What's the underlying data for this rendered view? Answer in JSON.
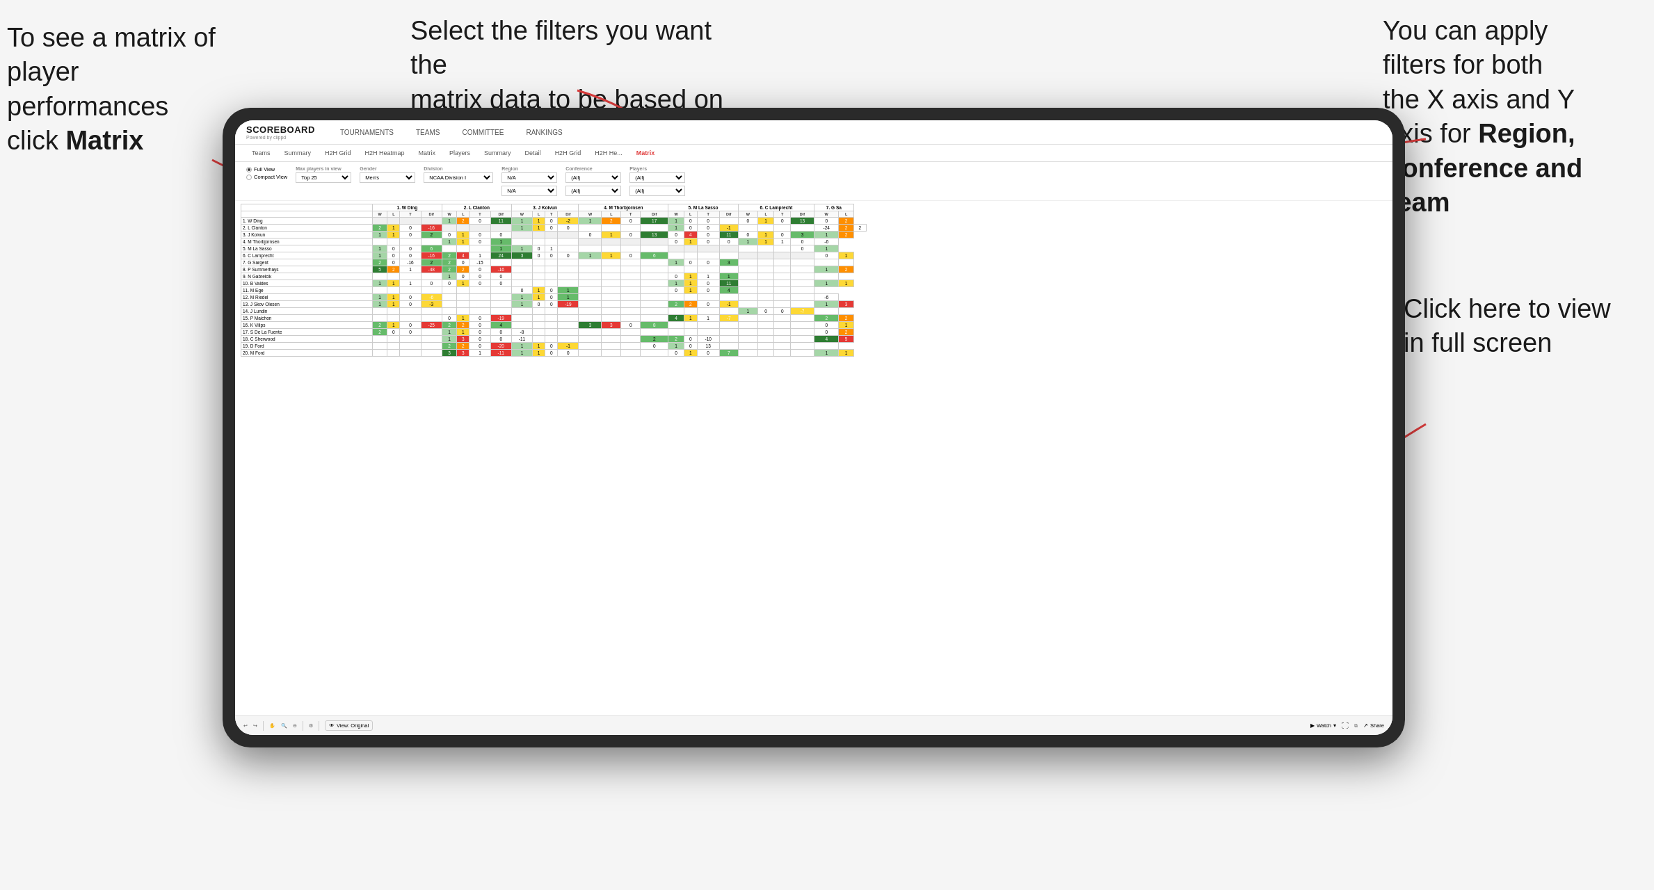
{
  "annotations": {
    "left": {
      "line1": "To see a matrix of",
      "line2": "player performances",
      "line3": "click ",
      "line3bold": "Matrix"
    },
    "center": {
      "line1": "Select the filters you want the",
      "line2": "matrix data to be based on"
    },
    "right": {
      "line1": "You  can apply",
      "line2": "filters for both",
      "line3": "the X axis and Y",
      "line4": "Axis for ",
      "line4bold": "Region,",
      "line5bold": "Conference and",
      "line6bold": "Team"
    },
    "bottomRight": {
      "line1": "Click here to view",
      "line2": "in full screen"
    }
  },
  "nav": {
    "logo": "SCOREBOARD",
    "poweredBy": "Powered by clippd",
    "items": [
      "TOURNAMENTS",
      "TEAMS",
      "COMMITTEE",
      "RANKINGS"
    ]
  },
  "subNav": {
    "items": [
      "Teams",
      "Summary",
      "H2H Grid",
      "H2H Heatmap",
      "Matrix",
      "Players",
      "Summary",
      "Detail",
      "H2H Grid",
      "H2H He...",
      "Matrix"
    ],
    "activeItem": "Matrix"
  },
  "filters": {
    "view": {
      "label": "",
      "options": [
        "Full View",
        "Compact View"
      ],
      "selected": "Full View"
    },
    "maxPlayers": {
      "label": "Max players in view",
      "value": "Top 25"
    },
    "gender": {
      "label": "Gender",
      "value": "Men's"
    },
    "division": {
      "label": "Division",
      "value": "NCAA Division I"
    },
    "region": {
      "label": "Region",
      "values": [
        "N/A",
        "N/A"
      ]
    },
    "conference": {
      "label": "Conference",
      "values": [
        "(All)",
        "(All)"
      ]
    },
    "players": {
      "label": "Players",
      "values": [
        "(All)",
        "(All)"
      ]
    }
  },
  "matrix": {
    "columnHeaders": [
      "1. W Ding",
      "2. L Clanton",
      "3. J Koivun",
      "4. M Thorbjornsen",
      "5. M La Sasso",
      "6. C Lamprecht",
      "7. G Sa"
    ],
    "subHeaders": [
      "W",
      "L",
      "T",
      "Dif"
    ],
    "rows": [
      {
        "name": "1. W Ding",
        "cells": [
          "",
          "",
          "",
          "",
          "1",
          "2",
          "0",
          "11",
          "1",
          "1",
          "0",
          "-2",
          "1",
          "2",
          "0",
          "17",
          "1",
          "0",
          "0",
          "",
          "0",
          "1",
          "0",
          "13",
          "0",
          "2"
        ]
      },
      {
        "name": "2. L Clanton",
        "cells": [
          "2",
          "1",
          "0",
          "-16",
          "",
          "",
          "",
          "",
          "1",
          "1",
          "0",
          "0",
          "",
          "",
          "",
          "",
          "1",
          "0",
          "0",
          "-1",
          "",
          "",
          "",
          "",
          "-24",
          "2",
          "2"
        ]
      },
      {
        "name": "3. J Koivun",
        "cells": [
          "1",
          "1",
          "0",
          "2",
          "0",
          "1",
          "0",
          "0",
          "",
          "",
          "",
          "",
          "0",
          "1",
          "0",
          "13",
          "0",
          "4",
          "0",
          "11",
          "0",
          "1",
          "0",
          "3",
          "1",
          "2"
        ]
      },
      {
        "name": "4. M Thorbjornsen",
        "cells": [
          "",
          "",
          "",
          "",
          "1",
          "1",
          "0",
          "1",
          "",
          "",
          "",
          "",
          "",
          "",
          "",
          "",
          "0",
          "1",
          "0",
          "0",
          "1",
          "1",
          "1",
          "0",
          "-6"
        ]
      },
      {
        "name": "5. M La Sasso",
        "cells": [
          "1",
          "0",
          "0",
          "6",
          "",
          "",
          "",
          "1",
          "1",
          "0",
          "1",
          "",
          "",
          "",
          "",
          "",
          "",
          "",
          "",
          "",
          "",
          "",
          "",
          "0",
          "1"
        ]
      },
      {
        "name": "6. C Lamprecht",
        "cells": [
          "1",
          "0",
          "0",
          "-16",
          "2",
          "4",
          "1",
          "24",
          "3",
          "0",
          "0",
          "0",
          "1",
          "1",
          "0",
          "6",
          "",
          "",
          "",
          "",
          "",
          "",
          "",
          "",
          "0",
          "1"
        ]
      },
      {
        "name": "7. G Sargent",
        "cells": [
          "2",
          "0",
          "-16",
          "2",
          "2",
          "0",
          "-15",
          "",
          "",
          "",
          "",
          "",
          "",
          "",
          "",
          "",
          "1",
          "0",
          "0",
          "3",
          "",
          "",
          "",
          "",
          "",
          ""
        ]
      },
      {
        "name": "8. P Summerhays",
        "cells": [
          "5",
          "2",
          "1",
          "-48",
          "2",
          "2",
          "0",
          "-16",
          "",
          "",
          "",
          "",
          "",
          "",
          "",
          "",
          "",
          "",
          "",
          "",
          "",
          "",
          "",
          "",
          "1",
          "2"
        ]
      },
      {
        "name": "9. N Gabrelcik",
        "cells": [
          "",
          "",
          "",
          "",
          "1",
          "0",
          "0",
          "0",
          "",
          "",
          "",
          "",
          "",
          "",
          "",
          "",
          "0",
          "1",
          "1",
          "1",
          "",
          "",
          "",
          "",
          ""
        ]
      },
      {
        "name": "10. B Valdes",
        "cells": [
          "1",
          "1",
          "1",
          "0",
          "0",
          "1",
          "0",
          "0",
          "",
          "",
          "",
          "",
          "",
          "",
          "",
          "",
          "1",
          "1",
          "0",
          "11",
          "",
          "",
          "",
          "",
          "1",
          "1"
        ]
      },
      {
        "name": "11. M Ege",
        "cells": [
          "",
          "",
          "",
          "",
          "",
          "",
          "",
          "",
          "0",
          "1",
          "0",
          "1",
          "",
          "",
          "",
          "",
          "0",
          "1",
          "0",
          "4",
          "",
          "",
          "",
          ""
        ]
      },
      {
        "name": "12. M Riedel",
        "cells": [
          "1",
          "1",
          "0",
          "-6",
          "",
          "",
          "",
          "",
          "1",
          "1",
          "0",
          "1",
          "",
          "",
          "",
          "",
          "",
          "",
          "",
          "",
          "",
          "",
          "",
          "",
          "-6"
        ]
      },
      {
        "name": "13. J Skov Olesen",
        "cells": [
          "1",
          "1",
          "0",
          "-3",
          "",
          "",
          "",
          "",
          "1",
          "0",
          "0",
          "-19",
          "",
          "",
          "",
          "",
          "2",
          "2",
          "0",
          "-1",
          "",
          "",
          "",
          "",
          "1",
          "3"
        ]
      },
      {
        "name": "14. J Lundin",
        "cells": [
          "",
          "",
          "",
          "",
          "",
          "",
          "",
          "",
          "",
          "",
          "",
          "",
          "",
          "",
          "",
          "",
          "",
          "",
          "",
          "",
          "1",
          "0",
          "0",
          "-7",
          ""
        ]
      },
      {
        "name": "15. P Maichon",
        "cells": [
          "",
          "",
          "",
          "",
          "0",
          "1",
          "0",
          "-19",
          "",
          "",
          "",
          "",
          "",
          "",
          "",
          "",
          "4",
          "1",
          "1",
          "-7",
          "",
          "",
          "",
          "",
          "2",
          "2"
        ]
      },
      {
        "name": "16. K Vilips",
        "cells": [
          "2",
          "1",
          "0",
          "-25",
          "2",
          "2",
          "0",
          "4",
          "",
          "",
          "",
          "",
          "3",
          "3",
          "0",
          "8",
          "",
          "",
          "",
          "",
          "",
          "",
          "",
          "",
          "0",
          "1"
        ]
      },
      {
        "name": "17. S De La Fuente",
        "cells": [
          "2",
          "0",
          "0",
          "",
          "1",
          "1",
          "0",
          "0",
          "-8",
          "",
          "",
          "",
          "",
          "",
          "",
          "",
          "",
          "",
          "",
          "",
          "",
          "",
          "",
          "",
          "0",
          "2"
        ]
      },
      {
        "name": "18. C Sherwood",
        "cells": [
          "",
          "",
          "",
          "",
          "1",
          "3",
          "0",
          "0",
          "-11",
          "",
          "",
          "",
          "",
          "",
          "",
          "2",
          "2",
          "0",
          "-10",
          "",
          "",
          "",
          "",
          "",
          "4",
          "5"
        ]
      },
      {
        "name": "19. D Ford",
        "cells": [
          "",
          "",
          "",
          "",
          "2",
          "2",
          "0",
          "-20",
          "1",
          "1",
          "0",
          "-1",
          "",
          "",
          "",
          "0",
          "1",
          "0",
          "13",
          "",
          "",
          "",
          "",
          "",
          ""
        ]
      },
      {
        "name": "20. M Ford",
        "cells": [
          "",
          "",
          "",
          "",
          "3",
          "3",
          "1",
          "-11",
          "1",
          "1",
          "0",
          "0",
          "",
          "",
          "",
          "",
          "0",
          "1",
          "0",
          "7",
          "",
          "",
          "",
          "",
          "1",
          "1"
        ]
      }
    ]
  },
  "toolbar": {
    "viewOriginal": "View: Original",
    "watch": "Watch",
    "share": "Share"
  },
  "colors": {
    "accent": "#e03e3e",
    "arrowColor": "#e03e3e"
  }
}
